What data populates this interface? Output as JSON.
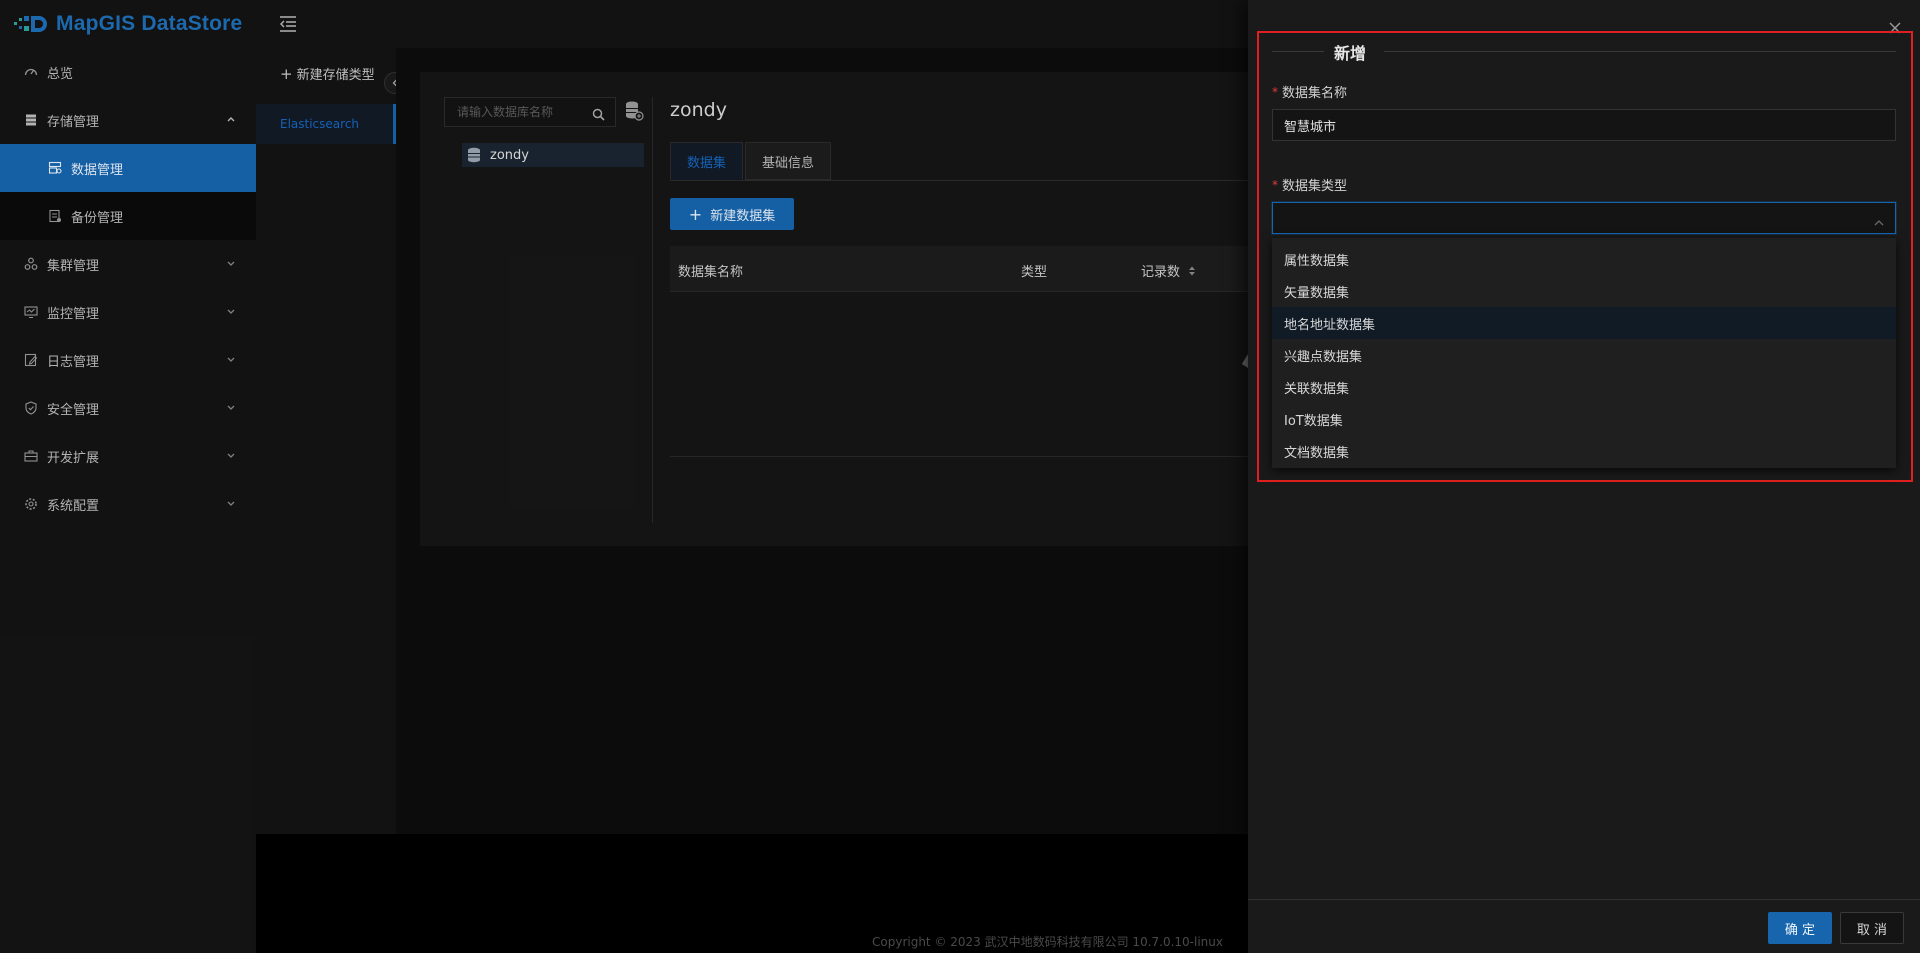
{
  "app": {
    "logo_text": "MapGIS DataStore",
    "brand_color": "#1f6fb8",
    "accent_color": "#1765ad"
  },
  "sidebar": {
    "items": [
      {
        "label": "总览",
        "icon": "dashboard-icon"
      },
      {
        "label": "存储管理",
        "icon": "storage-icon",
        "expanded": true,
        "children": [
          {
            "label": "数据管理",
            "icon": "data-manage-icon",
            "active": true
          },
          {
            "label": "备份管理",
            "icon": "backup-icon"
          }
        ]
      },
      {
        "label": "集群管理",
        "icon": "cluster-icon"
      },
      {
        "label": "监控管理",
        "icon": "monitor-icon"
      },
      {
        "label": "日志管理",
        "icon": "log-icon"
      },
      {
        "label": "安全管理",
        "icon": "shield-icon"
      },
      {
        "label": "开发扩展",
        "icon": "toolbox-icon"
      },
      {
        "label": "系统配置",
        "icon": "gear-icon"
      }
    ]
  },
  "types_panel": {
    "new_type_label": "新建存储类型",
    "selected_type": "Elasticsearch"
  },
  "database_panel": {
    "search_placeholder": "请输入数据库名称",
    "tree_items": [
      "zondy"
    ]
  },
  "main": {
    "title": "zondy",
    "tabs": [
      {
        "label": "数据集",
        "active": true
      },
      {
        "label": "基础信息",
        "active": false
      }
    ],
    "new_dataset_label": "新建数据集",
    "table_columns": [
      "数据集名称",
      "类型",
      "记录数"
    ]
  },
  "footer": {
    "copyright": "Copyright © 2023 武汉中地数码科技有限公司 10.7.0.10-linux"
  },
  "drawer": {
    "title": "新增",
    "fields": {
      "name_label": "数据集名称",
      "name_value": "智慧城市",
      "type_label": "数据集类型",
      "type_value": ""
    },
    "type_options": [
      {
        "label": "属性数据集",
        "hover": false
      },
      {
        "label": "矢量数据集",
        "hover": false
      },
      {
        "label": "地名地址数据集",
        "hover": true
      },
      {
        "label": "兴趣点数据集",
        "hover": false
      },
      {
        "label": "关联数据集",
        "hover": false
      },
      {
        "label": "IoT数据集",
        "hover": false
      },
      {
        "label": "文档数据集",
        "hover": false
      }
    ],
    "ok_label": "确 定",
    "cancel_label": "取 消",
    "highlight_color": "#e02020"
  }
}
